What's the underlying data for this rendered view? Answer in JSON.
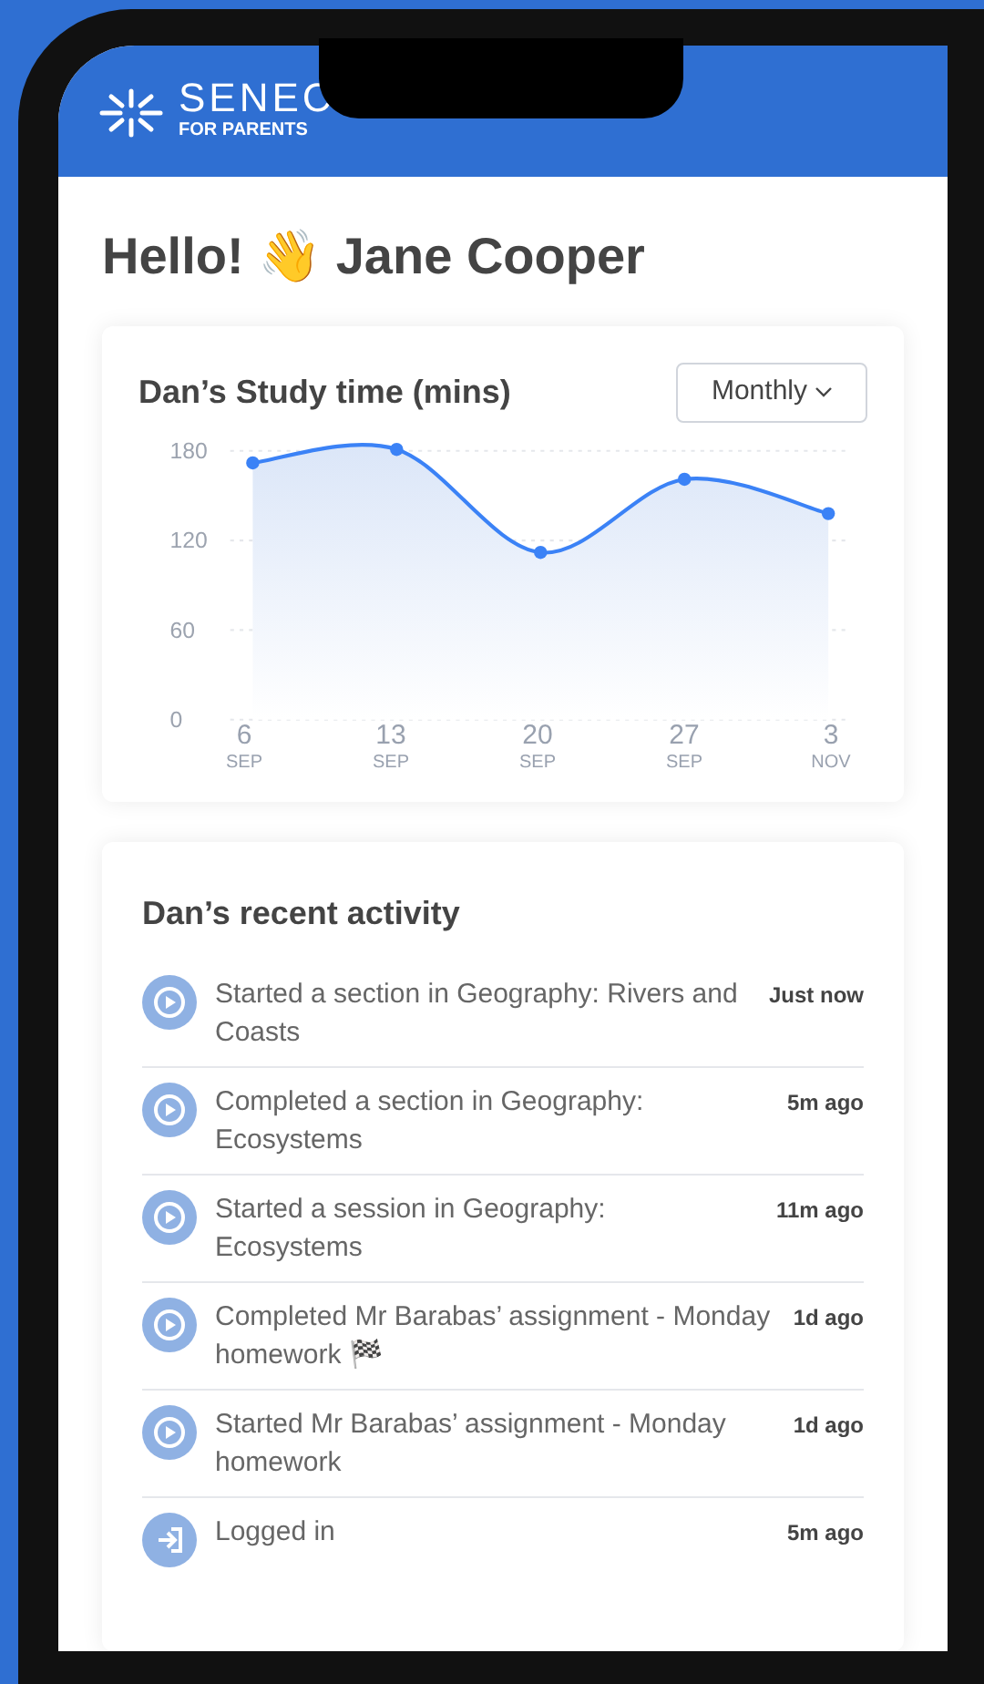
{
  "header": {
    "logo_text": "SENEC",
    "logo_subtitle": "FOR PARENTS"
  },
  "greeting": "Hello! 👋 Jane Cooper",
  "study_card": {
    "title": "Dan’s Study time (mins)",
    "period_dropdown": {
      "value": "Monthly"
    },
    "chart_data": {
      "type": "line",
      "categories": [
        "6\nSEP",
        "13\nSEP",
        "20\nSEP",
        "27\nSEP",
        "3\nNOV"
      ],
      "series": [
        {
          "color": "#3b82f6",
          "marker": "circle",
          "values": [
            172,
            181,
            112,
            161,
            138
          ]
        }
      ],
      "ylim": [
        0,
        184
      ],
      "yticks": [
        0,
        60,
        120,
        180
      ],
      "grid": true
    }
  },
  "activity_card": {
    "title": "Dan’s recent activity",
    "items": [
      {
        "kind": "play",
        "text": "Started a section in Geography: Rivers and Coasts",
        "time": "Just now"
      },
      {
        "kind": "play",
        "text": "Completed a section in Geography: Ecosystems",
        "time": "5m ago"
      },
      {
        "kind": "play",
        "text": "Started a session in Geography: Ecosystems",
        "time": "11m ago"
      },
      {
        "kind": "play",
        "text": "Completed Mr Barabas’ assignment - Monday homework 🏁",
        "time": "1d ago"
      },
      {
        "kind": "play",
        "text": "Started Mr Barabas’ assignment - Monday homework",
        "time": "1d ago"
      },
      {
        "kind": "login",
        "text": "Logged in",
        "time": "5m ago"
      }
    ]
  }
}
